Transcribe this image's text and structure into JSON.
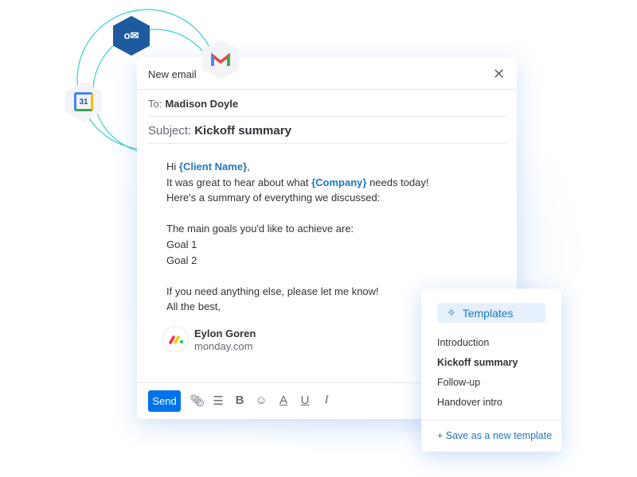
{
  "email": {
    "title": "New email",
    "to_label": "To:",
    "to_value": "Madison Doyle",
    "subject_label": "Subject:",
    "subject_value": "Kickoff summary",
    "body": {
      "greeting": "Hi ",
      "client_placeholder": "{Client Name}",
      "greeting_end": ",",
      "line2_a": "It was great to hear about what ",
      "company_placeholder": "{Company}",
      "line2_b": " needs today!",
      "line3": "Here's a summary of everything we discussed:",
      "line4": "The main goals you'd like to achieve are:",
      "goal1": "Goal 1",
      "goal2": "Goal 2",
      "line5": "If you need anything else, please let me know!",
      "line6": "All the best,"
    },
    "signature": {
      "name": "Eylon Goren",
      "domain": "monday.com"
    },
    "toolbar": {
      "send": "Send",
      "icons": [
        "attachment-icon",
        "list-icon",
        "bold-icon",
        "emoji-icon",
        "text-color-icon",
        "underline-icon",
        "italic-icon"
      ]
    }
  },
  "templates": {
    "title": "Templates",
    "items": [
      "Introduction",
      "Kickoff summary",
      "Follow-up",
      "Handover intro"
    ],
    "selected": "Kickoff summary",
    "save_link": "+ Save as a new template"
  },
  "integrations": [
    "outlook-icon",
    "gmail-icon",
    "google-calendar-icon"
  ],
  "calendar_day": "31",
  "colors": {
    "accent": "#0073ea",
    "link": "#1f76c2",
    "orbit": "#3ccfcf",
    "outlook": "#1e5a9e"
  }
}
